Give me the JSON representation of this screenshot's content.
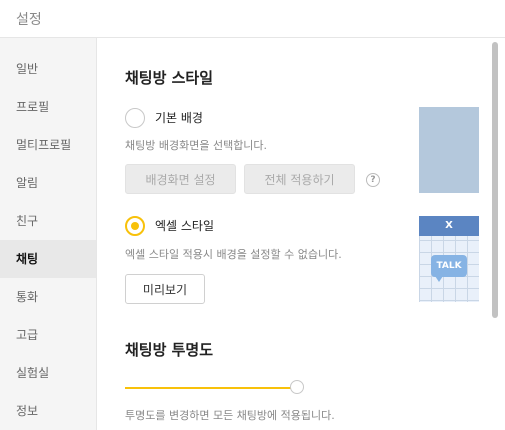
{
  "window": {
    "title": "설정"
  },
  "sidebar": {
    "items": [
      {
        "label": "일반"
      },
      {
        "label": "프로필"
      },
      {
        "label": "멀티프로필"
      },
      {
        "label": "알림"
      },
      {
        "label": "친구"
      },
      {
        "label": "채팅",
        "active": true
      },
      {
        "label": "통화"
      },
      {
        "label": "고급"
      },
      {
        "label": "실험실"
      },
      {
        "label": "정보"
      }
    ]
  },
  "chat_style": {
    "heading": "채팅방 스타일",
    "basic": {
      "label": "기본 배경",
      "checked": false,
      "description": "채팅방 배경화면을 선택합니다.",
      "set_bg_button": "배경화면 설정",
      "apply_all_button": "전체 적용하기",
      "help": "?"
    },
    "excel": {
      "label": "엑셀 스타일",
      "checked": true,
      "description": "엑셀 스타일 적용시 배경을 설정할 수 없습니다.",
      "preview_button": "미리보기",
      "thumb_header": "X",
      "thumb_talk": "TALK"
    }
  },
  "transparency": {
    "heading": "채팅방 투명도",
    "value_fraction": 1.0,
    "description": "투명도를 변경하면 모든 채팅방에 적용됩니다."
  },
  "colors": {
    "accent": "#f8c10a",
    "sidebar_bg": "#f5f5f5",
    "excel_blue": "#5b85c2"
  }
}
